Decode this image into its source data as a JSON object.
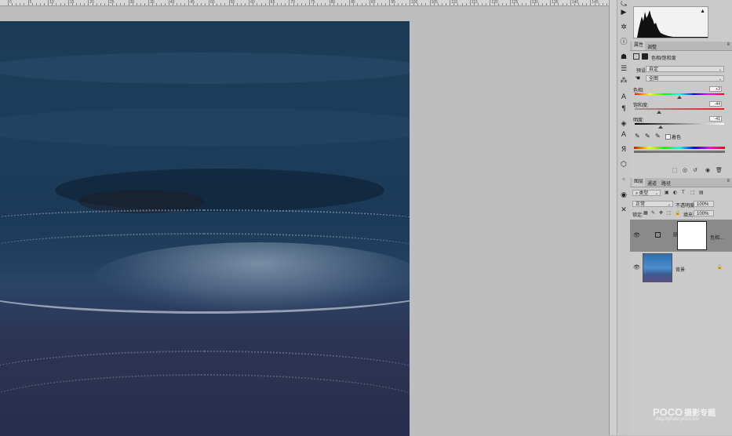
{
  "ruler": {
    "labels": [
      "0",
      "5",
      "10",
      "15",
      "20",
      "25",
      "30",
      "35",
      "40",
      "45",
      "50",
      "55",
      "60",
      "65",
      "70",
      "75",
      "80",
      "85",
      "90",
      "95",
      "100",
      "105",
      "110",
      "115",
      "120",
      "125",
      "130",
      "135",
      "140",
      "145",
      "150"
    ]
  },
  "panels": {
    "properties_tab": "属性",
    "adjust_tab": "调整",
    "adjustment_title": "色相/饱和度",
    "preset_label": "预设:",
    "preset_value": "自定",
    "channel_value": "全图",
    "hue_label": "色相:",
    "hue_value": "+3",
    "sat_label": "饱和度:",
    "sat_value": "-44",
    "light_label": "明度:",
    "light_value": "-41",
    "colorize_label": "着色",
    "layers_tab": "图层",
    "channels_tab": "通道",
    "paths_tab": "路径",
    "kind_filter": "类型",
    "blend_mode": "正常",
    "opacity_label": "不透明度:",
    "opacity_value": "100%",
    "lock_label": "锁定:",
    "fill_label": "填充:",
    "fill_value": "100%",
    "layer1_name": "色相...",
    "layer2_name": "背景"
  },
  "watermark": {
    "brand": "POCO",
    "brand_cn": "摄影专题",
    "url": "http://photo.poco.cn/"
  },
  "colors": {
    "panel_bg": "#cacaca",
    "canvas_bg": "#bebebe",
    "photo_dark": "#1d3b57"
  }
}
